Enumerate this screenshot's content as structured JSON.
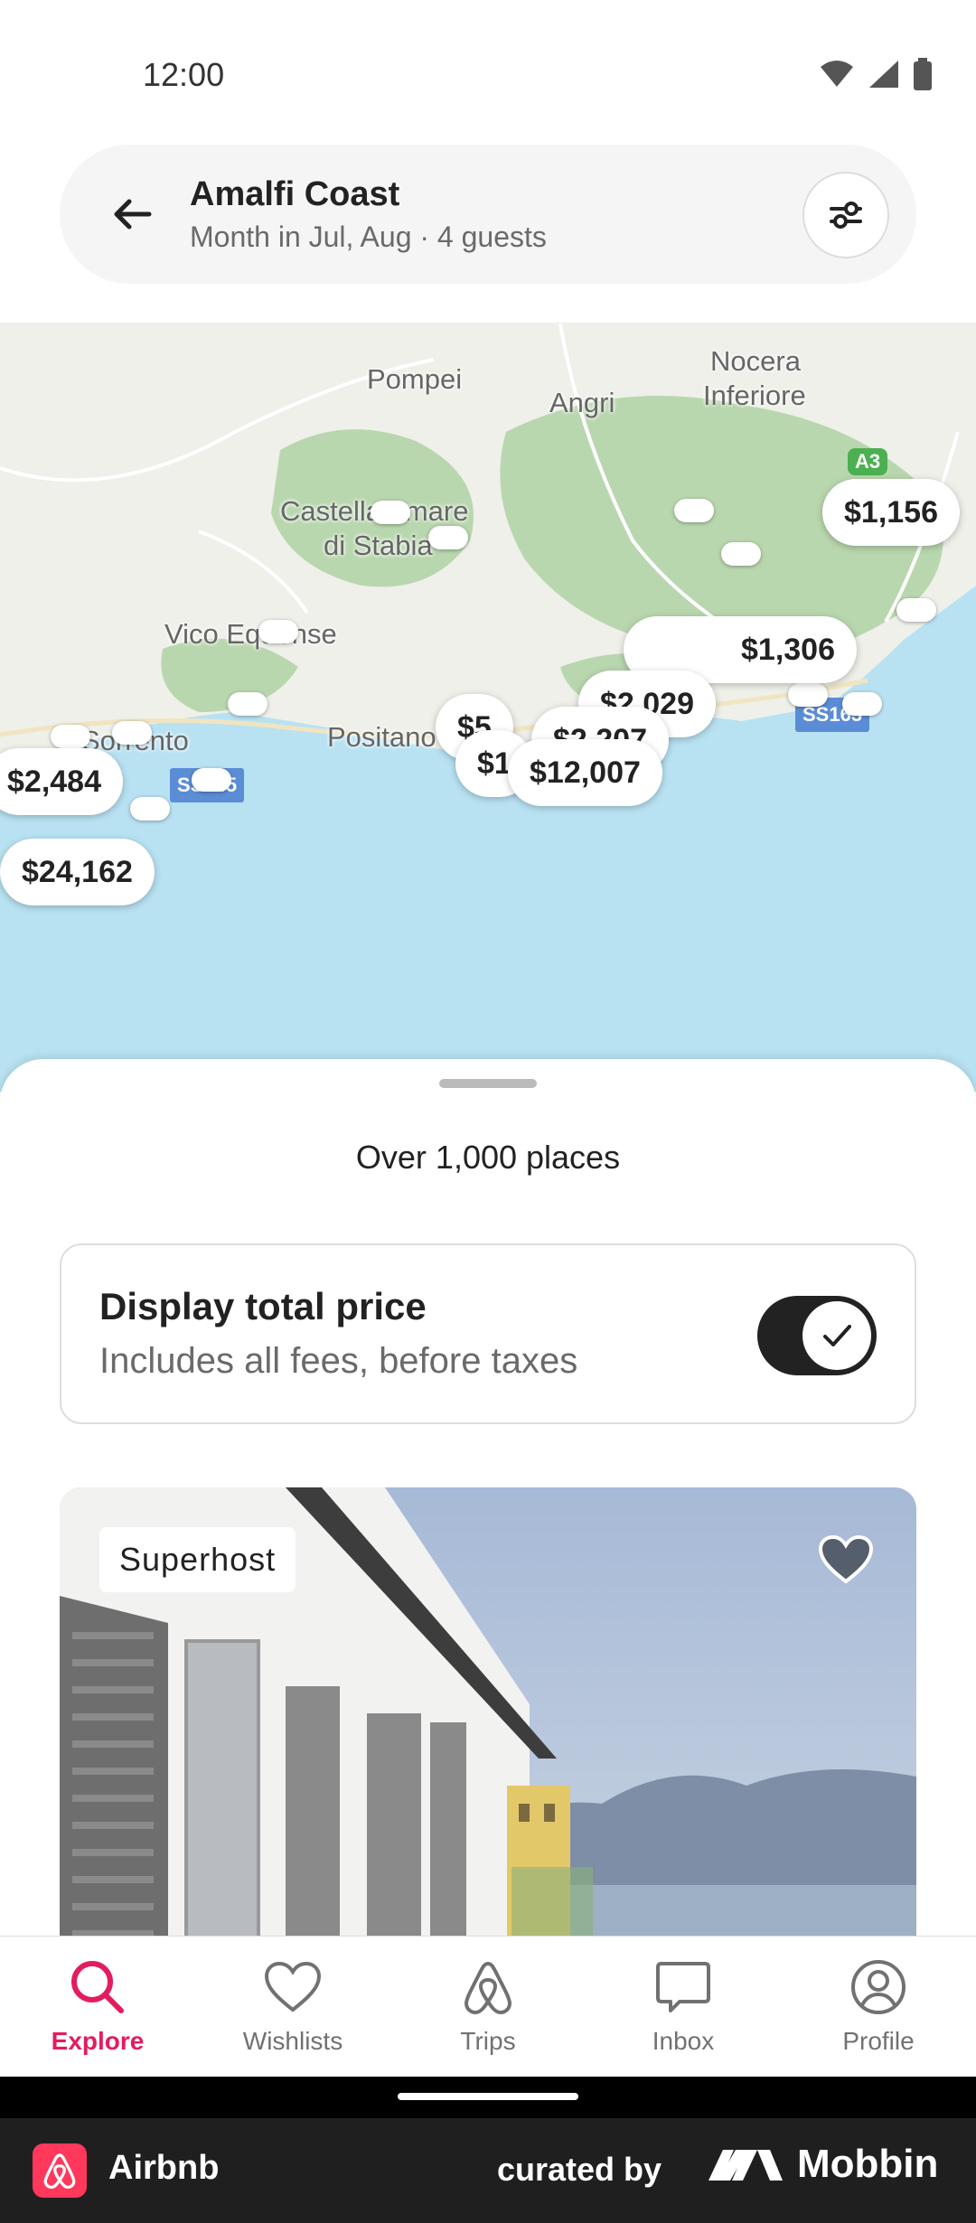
{
  "status_bar": {
    "time": "12:00"
  },
  "search": {
    "title": "Amalfi Coast",
    "subtitle": "Month in Jul, Aug · 4 guests"
  },
  "map": {
    "places": [
      "Pompei",
      "Angri",
      "Nocera",
      "Inferiore",
      "Castellammare",
      "di Stabia",
      "Vico Equense",
      "Sorrento",
      "Positano"
    ],
    "roads": [
      "A3",
      "SS163",
      "SS145"
    ],
    "prices": [
      "$1,156",
      "$2,484",
      "$24,162",
      "$12,007",
      "$2,029",
      "$1,306",
      "$5",
      "$1",
      "$2,207"
    ]
  },
  "sheet": {
    "title": "Over 1,000 places",
    "total_price": {
      "title": "Display total price",
      "subtitle": "Includes all fees, before taxes",
      "enabled": true
    }
  },
  "listing": {
    "badge": "Superhost"
  },
  "tabs": [
    {
      "label": "Explore",
      "icon": "search-icon",
      "active": true
    },
    {
      "label": "Wishlists",
      "icon": "heart-icon",
      "active": false
    },
    {
      "label": "Trips",
      "icon": "airbnb-logo-icon",
      "active": false
    },
    {
      "label": "Inbox",
      "icon": "message-icon",
      "active": false
    },
    {
      "label": "Profile",
      "icon": "user-circle-icon",
      "active": false
    }
  ],
  "footer": {
    "app_name": "Airbnb",
    "curated_by": "curated by",
    "brand": "Mobbin"
  },
  "colors": {
    "accent": "#e31c5f",
    "airbnb": "#ff385c",
    "sea": "#b8e2f2",
    "land": "#eef0e9",
    "forest": "#b9d7ae"
  }
}
